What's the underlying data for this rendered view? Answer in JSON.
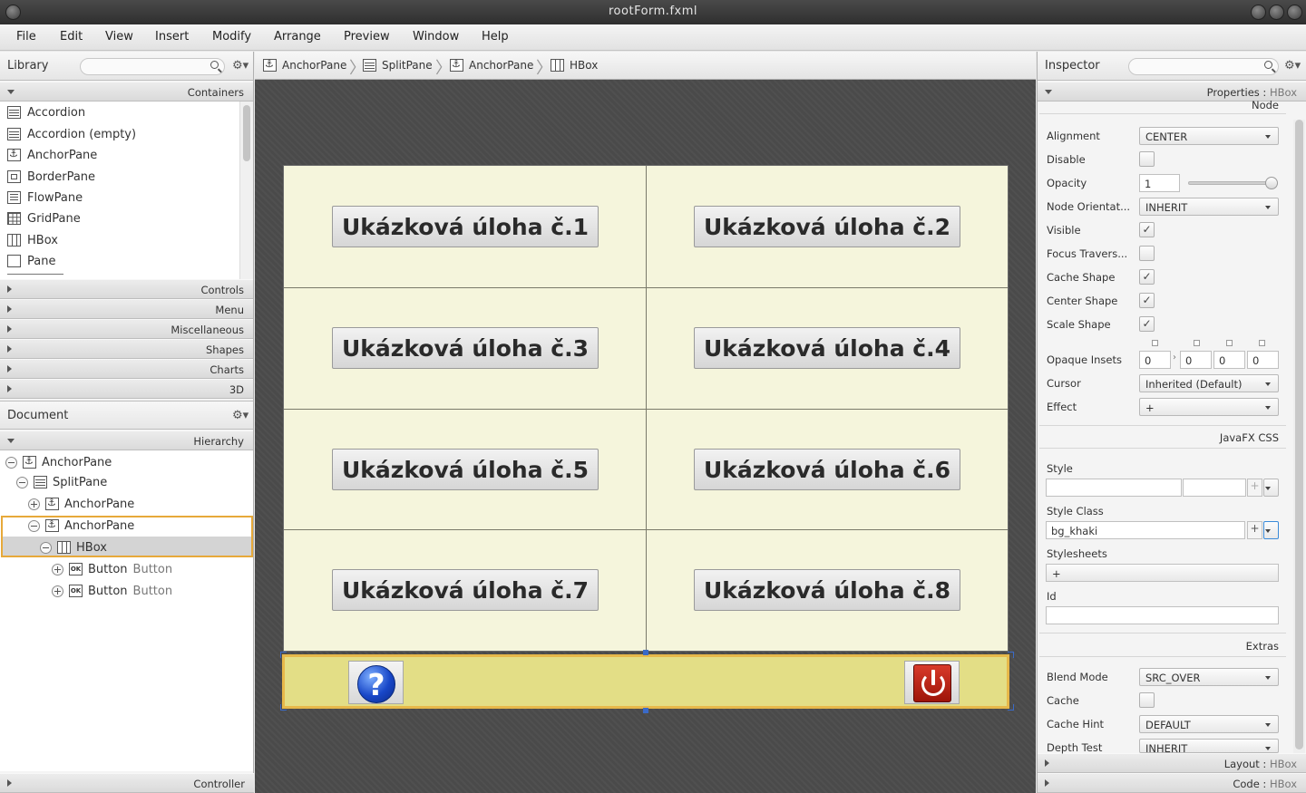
{
  "window": {
    "title": "rootForm.fxml"
  },
  "menu": [
    "File",
    "Edit",
    "View",
    "Insert",
    "Modify",
    "Arrange",
    "Preview",
    "Window",
    "Help"
  ],
  "library": {
    "title": "Library",
    "sections": {
      "containers": "Containers",
      "controls": "Controls",
      "menu": "Menu",
      "misc": "Miscellaneous",
      "shapes": "Shapes",
      "charts": "Charts",
      "three_d": "3D"
    },
    "items": [
      "Accordion",
      "Accordion  (empty)",
      "AnchorPane",
      "BorderPane",
      "FlowPane",
      "GridPane",
      "HBox",
      "Pane"
    ]
  },
  "document": {
    "title": "Document",
    "hierarchy_label": "Hierarchy",
    "controller_label": "Controller",
    "tree": [
      {
        "label": "AnchorPane"
      },
      {
        "label": "SplitPane"
      },
      {
        "label": "AnchorPane"
      },
      {
        "label": "AnchorPane"
      },
      {
        "label": "HBox"
      },
      {
        "label": "Button",
        "sub": "Button"
      },
      {
        "label": "Button",
        "sub": "Button"
      }
    ]
  },
  "breadcrumb": [
    "AnchorPane",
    "SplitPane",
    "AnchorPane",
    "HBox"
  ],
  "canvas": {
    "tasks": [
      "Ukázková úloha č.1",
      "Ukázková úloha č.2",
      "Ukázková úloha č.3",
      "Ukázková úloha č.4",
      "Ukázková úloha č.5",
      "Ukázková úloha č.6",
      "Ukázková úloha č.7",
      "Ukázková úloha č.8"
    ],
    "help_glyph": "?",
    "bg_color": "#f5f5dc",
    "hbox_color": "#e3de86",
    "selection_color": "#e7b84a"
  },
  "inspector": {
    "title": "Inspector",
    "properties_label": "Properties :",
    "properties_target": "HBox",
    "node_label": "Node",
    "alignment": {
      "label": "Alignment",
      "value": "CENTER"
    },
    "disable": {
      "label": "Disable",
      "checked": false
    },
    "opacity": {
      "label": "Opacity",
      "value": "1",
      "slider": 1.0
    },
    "node_orientation": {
      "label": "Node Orientat...",
      "value": "INHERIT"
    },
    "visible": {
      "label": "Visible",
      "checked": true
    },
    "focus_traversable": {
      "label": "Focus Travers...",
      "checked": false
    },
    "cache_shape": {
      "label": "Cache Shape",
      "checked": true
    },
    "center_shape": {
      "label": "Center Shape",
      "checked": true
    },
    "scale_shape": {
      "label": "Scale Shape",
      "checked": true
    },
    "opaque_insets": {
      "label": "Opaque Insets",
      "values": [
        "0",
        "0",
        "0",
        "0"
      ]
    },
    "cursor": {
      "label": "Cursor",
      "value": "Inherited (Default)"
    },
    "effect": {
      "label": "Effect",
      "value": "+"
    },
    "javafx_css_label": "JavaFX CSS",
    "style": {
      "label": "Style",
      "value": ""
    },
    "style_class": {
      "label": "Style Class",
      "value": "bg_khaki"
    },
    "stylesheets": {
      "label": "Stylesheets",
      "value": "+"
    },
    "id": {
      "label": "Id",
      "value": ""
    },
    "extras_label": "Extras",
    "blend_mode": {
      "label": "Blend Mode",
      "value": "SRC_OVER"
    },
    "cache": {
      "label": "Cache",
      "checked": false
    },
    "cache_hint": {
      "label": "Cache Hint",
      "value": "DEFAULT"
    },
    "depth_test": {
      "label": "Depth Test",
      "value": "INHERIT"
    },
    "layout_label": "Layout :",
    "layout_target": "HBox",
    "code_label": "Code :",
    "code_target": "HBox"
  }
}
